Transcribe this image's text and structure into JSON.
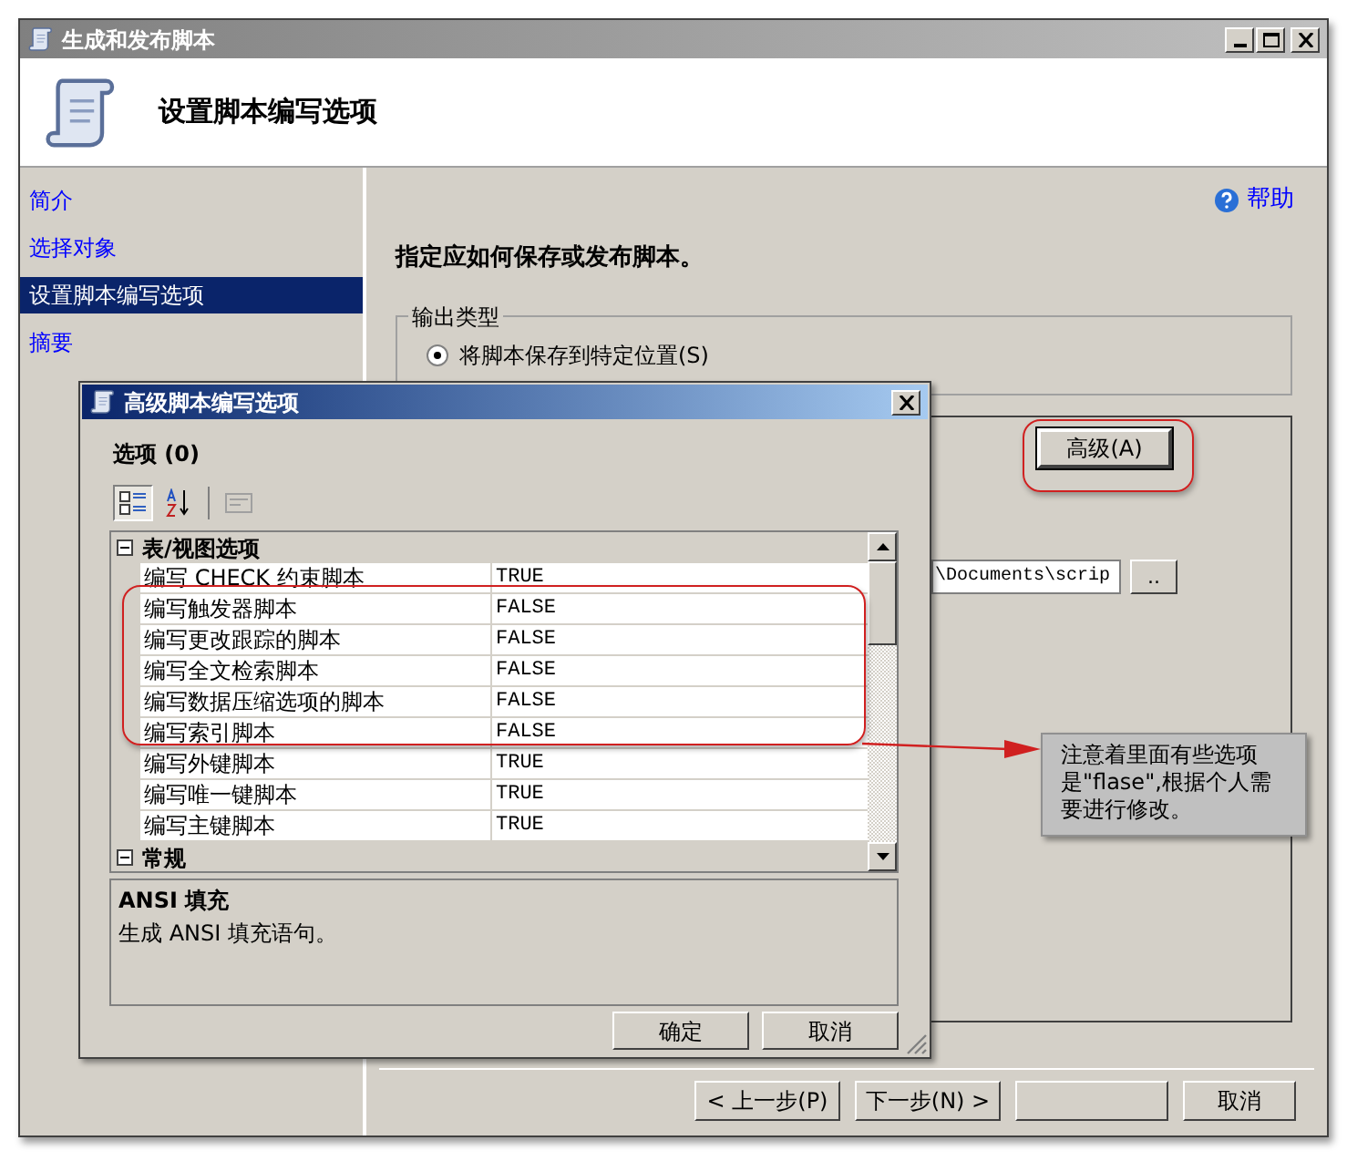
{
  "window": {
    "title": "生成和发布脚本"
  },
  "header": {
    "title": "设置脚本编写选项"
  },
  "sidebar": {
    "items": [
      {
        "label": "简介",
        "selected": false
      },
      {
        "label": "选择对象",
        "selected": false
      },
      {
        "label": "设置脚本编写选项",
        "selected": true
      },
      {
        "label": "摘要",
        "selected": false
      }
    ]
  },
  "help": "帮助",
  "instruction": "指定应如何保存或发布脚本。",
  "output_type": {
    "legend": "输出类型",
    "options": [
      {
        "label": "将脚本保存到特定位置(S)",
        "selected": true
      }
    ]
  },
  "advanced_button": "高级(A)",
  "file_path": {
    "value": "\\Documents\\scrip",
    "browse": ".."
  },
  "nav_buttons": [
    {
      "kind": "text",
      "label": "< 上一步(P)"
    },
    {
      "kind": "text",
      "label": "下一步(N) >"
    },
    {
      "kind": "covered"
    },
    {
      "kind": "text",
      "label": "取消"
    }
  ],
  "dialog": {
    "title": "高级脚本编写选项",
    "options_label": "选项 (0)",
    "toolbar": [
      {
        "kind": "categorized",
        "selected": true
      },
      {
        "kind": "alphabetical",
        "selected": false
      },
      {
        "kind": "pages",
        "disabled": true
      }
    ],
    "grid": [
      {
        "category": "表/视图选项",
        "expanded": true,
        "rows": [
          {
            "name": "编写 CHECK 约束脚本",
            "value": "TRUE"
          },
          {
            "name": "编写触发器脚本",
            "value": "FALSE"
          },
          {
            "name": "编写更改跟踪的脚本",
            "value": "FALSE"
          },
          {
            "name": "编写全文检索脚本",
            "value": "FALSE"
          },
          {
            "name": "编写数据压缩选项的脚本",
            "value": "FALSE"
          },
          {
            "name": "编写索引脚本",
            "value": "FALSE"
          },
          {
            "name": "编写外键脚本",
            "value": "TRUE"
          },
          {
            "name": "编写唯一键脚本",
            "value": "TRUE"
          },
          {
            "name": "编写主键脚本",
            "value": "TRUE"
          }
        ]
      },
      {
        "category": "常规",
        "expanded": true
      }
    ],
    "description": {
      "title": "ANSI 填充",
      "text": "生成 ANSI 填充语句。"
    },
    "buttons": [
      "确定",
      "取消"
    ]
  },
  "annotation": {
    "text": "注意着里面有些选项是\"flase\",根据个人需要进行修改。"
  }
}
